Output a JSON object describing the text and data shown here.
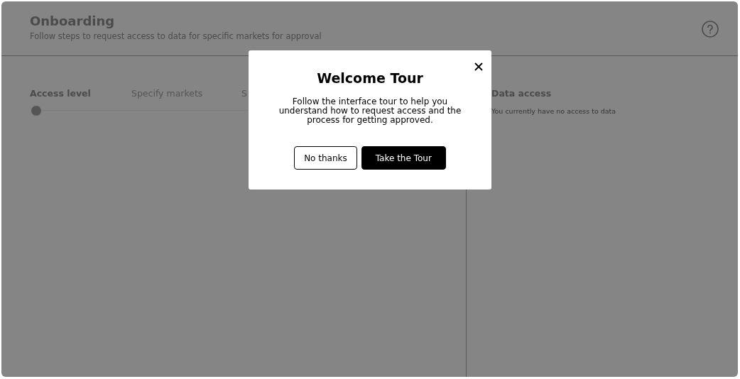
{
  "header": {
    "title": "Onboarding",
    "subtitle": "Follow steps to request access to data for specific markets for approval"
  },
  "steps": [
    {
      "label": "Access level",
      "selected": true
    },
    {
      "label": "Specify markets",
      "selected": false
    },
    {
      "label": "S",
      "selected": false
    }
  ],
  "side_panel": {
    "title": "Data access",
    "message": "You currently have no access to data"
  },
  "dialog": {
    "title": "Welcome Tour",
    "message": "Follow the interface tour to help you understand how to request access and the process for getting approved.",
    "buttons": [
      {
        "label": "No thanks",
        "kind": "secondary"
      },
      {
        "label": "Take the Tour",
        "kind": "primary"
      }
    ]
  }
}
